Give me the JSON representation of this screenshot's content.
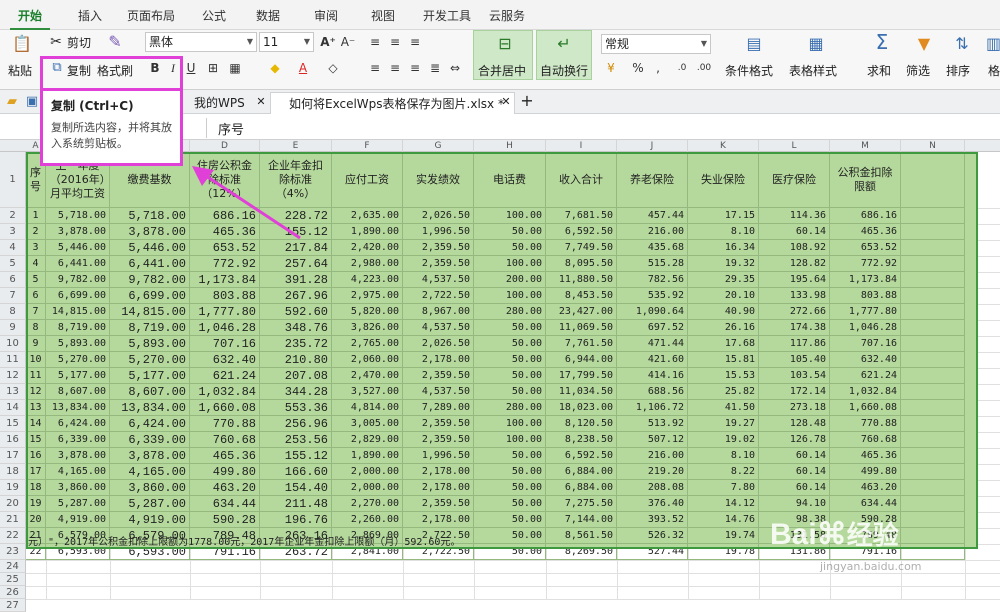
{
  "menu": {
    "tabs": [
      "开始",
      "插入",
      "页面布局",
      "公式",
      "数据",
      "审阅",
      "视图",
      "开发工具",
      "云服务"
    ]
  },
  "ribbon": {
    "paste": "粘贴",
    "cut": "剪切",
    "copy": "复制",
    "format_painter": "格式刷",
    "font_name": "黑体",
    "font_size": "11",
    "merge_center": "合并居中",
    "wrap_text": "自动换行",
    "number_format": "常规",
    "conditional_format": "条件格式",
    "table_style": "表格样式",
    "sum": "求和",
    "filter": "筛选",
    "sort": "排序",
    "format_cut": "格"
  },
  "doc_tabs": {
    "wps": "我的WPS",
    "file": "如何将ExcelWps表格保存为图片.xlsx *"
  },
  "formula_bar": {
    "value": "序号"
  },
  "tooltip": {
    "title": "复制 (Ctrl+C)",
    "description": "复制所选内容，并将其放入系统剪贴板。"
  },
  "columns": [
    "A",
    "B",
    "C",
    "D",
    "E",
    "F",
    "G",
    "H",
    "I",
    "J",
    "K",
    "L",
    "M",
    "N"
  ],
  "row_numbers": [
    "1",
    "2",
    "3",
    "4",
    "5",
    "6",
    "7",
    "8",
    "9",
    "10",
    "11",
    "12",
    "13",
    "14",
    "15",
    "16",
    "17",
    "18",
    "19",
    "20",
    "21",
    "22",
    "23",
    "24",
    "25",
    "26",
    "27"
  ],
  "table": {
    "headers": [
      "序号",
      "上一年度（2016年）月平均工资",
      "缴费基数",
      "住房公积金除标准（12%）",
      "企业年金扣除标准（4%）",
      "应付工资",
      "实发绩效",
      "电话费",
      "收入合计",
      "养老保险",
      "失业保险",
      "医疗保险",
      "公积金扣除限额",
      ""
    ],
    "rows": [
      [
        "1",
        "5,718.00",
        "5,718.00",
        "686.16",
        "228.72",
        "2,635.00",
        "2,026.50",
        "100.00",
        "7,681.50",
        "457.44",
        "17.15",
        "114.36",
        "686.16"
      ],
      [
        "2",
        "3,878.00",
        "3,878.00",
        "465.36",
        "155.12",
        "1,890.00",
        "1,996.50",
        "50.00",
        "6,592.50",
        "216.00",
        "8.10",
        "60.14",
        "465.36"
      ],
      [
        "3",
        "5,446.00",
        "5,446.00",
        "653.52",
        "217.84",
        "2,420.00",
        "2,359.50",
        "50.00",
        "7,749.50",
        "435.68",
        "16.34",
        "108.92",
        "653.52"
      ],
      [
        "4",
        "6,441.00",
        "6,441.00",
        "772.92",
        "257.64",
        "2,980.00",
        "2,359.50",
        "100.00",
        "8,095.50",
        "515.28",
        "19.32",
        "128.82",
        "772.92"
      ],
      [
        "5",
        "9,782.00",
        "9,782.00",
        "1,173.84",
        "391.28",
        "4,223.00",
        "4,537.50",
        "200.00",
        "11,880.50",
        "782.56",
        "29.35",
        "195.64",
        "1,173.84"
      ],
      [
        "6",
        "6,699.00",
        "6,699.00",
        "803.88",
        "267.96",
        "2,975.00",
        "2,722.50",
        "100.00",
        "8,453.50",
        "535.92",
        "20.10",
        "133.98",
        "803.88"
      ],
      [
        "7",
        "14,815.00",
        "14,815.00",
        "1,777.80",
        "592.60",
        "5,820.00",
        "8,967.00",
        "280.00",
        "23,427.00",
        "1,090.64",
        "40.90",
        "272.66",
        "1,777.80"
      ],
      [
        "8",
        "8,719.00",
        "8,719.00",
        "1,046.28",
        "348.76",
        "3,826.00",
        "4,537.50",
        "50.00",
        "11,069.50",
        "697.52",
        "26.16",
        "174.38",
        "1,046.28"
      ],
      [
        "9",
        "5,893.00",
        "5,893.00",
        "707.16",
        "235.72",
        "2,765.00",
        "2,026.50",
        "50.00",
        "7,761.50",
        "471.44",
        "17.68",
        "117.86",
        "707.16"
      ],
      [
        "10",
        "5,270.00",
        "5,270.00",
        "632.40",
        "210.80",
        "2,060.00",
        "2,178.00",
        "50.00",
        "6,944.00",
        "421.60",
        "15.81",
        "105.40",
        "632.40"
      ],
      [
        "11",
        "5,177.00",
        "5,177.00",
        "621.24",
        "207.08",
        "2,470.00",
        "2,359.50",
        "50.00",
        "17,799.50",
        "414.16",
        "15.53",
        "103.54",
        "621.24"
      ],
      [
        "12",
        "8,607.00",
        "8,607.00",
        "1,032.84",
        "344.28",
        "3,527.00",
        "4,537.50",
        "50.00",
        "11,034.50",
        "688.56",
        "25.82",
        "172.14",
        "1,032.84"
      ],
      [
        "13",
        "13,834.00",
        "13,834.00",
        "1,660.08",
        "553.36",
        "4,814.00",
        "7,289.00",
        "280.00",
        "18,023.00",
        "1,106.72",
        "41.50",
        "273.18",
        "1,660.08"
      ],
      [
        "14",
        "6,424.00",
        "6,424.00",
        "770.88",
        "256.96",
        "3,005.00",
        "2,359.50",
        "100.00",
        "8,120.50",
        "513.92",
        "19.27",
        "128.48",
        "770.88"
      ],
      [
        "15",
        "6,339.00",
        "6,339.00",
        "760.68",
        "253.56",
        "2,829.00",
        "2,359.50",
        "100.00",
        "8,238.50",
        "507.12",
        "19.02",
        "126.78",
        "760.68"
      ],
      [
        "16",
        "3,878.00",
        "3,878.00",
        "465.36",
        "155.12",
        "1,890.00",
        "1,996.50",
        "50.00",
        "6,592.50",
        "216.00",
        "8.10",
        "60.14",
        "465.36"
      ],
      [
        "17",
        "4,165.00",
        "4,165.00",
        "499.80",
        "166.60",
        "2,000.00",
        "2,178.00",
        "50.00",
        "6,884.00",
        "219.20",
        "8.22",
        "60.14",
        "499.80"
      ],
      [
        "18",
        "3,860.00",
        "3,860.00",
        "463.20",
        "154.40",
        "2,000.00",
        "2,178.00",
        "50.00",
        "6,884.00",
        "208.08",
        "7.80",
        "60.14",
        "463.20"
      ],
      [
        "19",
        "5,287.00",
        "5,287.00",
        "634.44",
        "211.48",
        "2,270.00",
        "2,359.50",
        "50.00",
        "7,275.50",
        "376.40",
        "14.12",
        "94.10",
        "634.44"
      ],
      [
        "20",
        "4,919.00",
        "4,919.00",
        "590.28",
        "196.76",
        "2,260.00",
        "2,178.00",
        "50.00",
        "7,144.00",
        "393.52",
        "14.76",
        "98.38",
        "590.28"
      ],
      [
        "21",
        "6,579.00",
        "6,579.00",
        "789.48",
        "263.16",
        "2,869.00",
        "2,722.50",
        "50.00",
        "8,561.50",
        "526.32",
        "19.74",
        "131.58",
        "789.48"
      ],
      [
        "22",
        "6,593.00",
        "6,593.00",
        "791.16",
        "263.72",
        "2,841.00",
        "2,722.50",
        "50.00",
        "8,269.50",
        "527.44",
        "19.78",
        "131.86",
        "791.16"
      ]
    ],
    "note": "元）\"，2017年公积金扣除上限额为1778.00元，2017年企业年金扣除上限额（月）592.60元。"
  },
  "watermark": {
    "brand": "Bai",
    "brand2": "经验",
    "site": "jingyan.baidu.com"
  },
  "colors": {
    "table_fill": "#b5d99c",
    "highlight": "#e040d8",
    "accent": "#2f8f3c"
  }
}
